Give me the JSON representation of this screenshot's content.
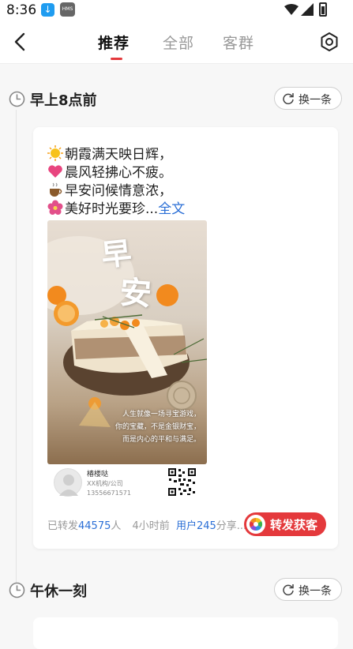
{
  "status": {
    "time": "8:36",
    "hms": "HMS"
  },
  "nav": {
    "tabs": [
      "推荐",
      "全部",
      "客群"
    ]
  },
  "sections": [
    {
      "title": "早上8点前",
      "swap_label": "换一条"
    },
    {
      "title": "午休一刻",
      "swap_label": "换一条"
    }
  ],
  "post": {
    "lines": [
      "朝霞满天映日辉，",
      "晨风轻拂心不疲。",
      "早安问候情意浓，",
      "美好时光要珍..."
    ],
    "more_label": "全文",
    "emojis": [
      "sun-emoji",
      "heart-emoji",
      "coffee-emoji",
      "flower-emoji"
    ],
    "poster": {
      "title_1": "早",
      "title_2": "安",
      "caption": [
        "人生就像一场寻宝游戏，",
        "你的宝藏，不是金银财宝，",
        "而是内心的平和与满足。"
      ]
    },
    "bizcard": {
      "name": "椿楼哒",
      "org": "XX机构/公司",
      "phone": "13556671571"
    },
    "meta": {
      "prefix": "已转发",
      "count": "44575",
      "suffix": "人",
      "time": "4小时前",
      "user_prefix": "用户",
      "user_id": "245",
      "user_suffix": "分享..."
    },
    "share_label": "转发获客"
  },
  "colors": {
    "accent": "#e4393c",
    "link": "#2b6fd6"
  }
}
